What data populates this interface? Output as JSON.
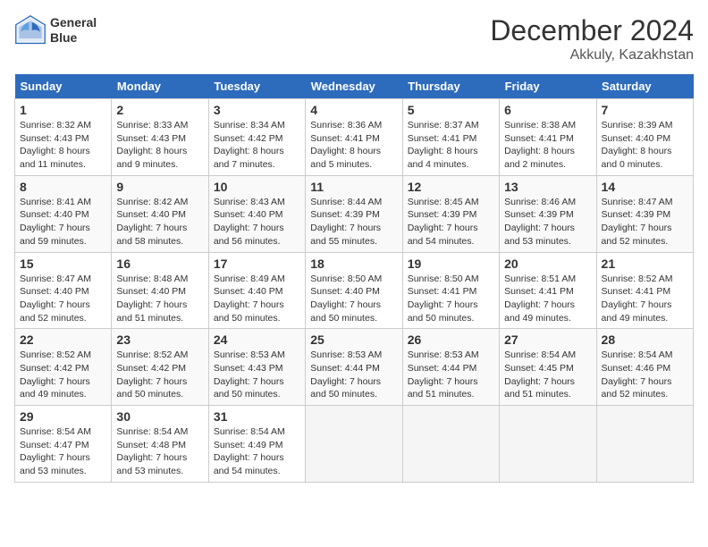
{
  "logo": {
    "line1": "General",
    "line2": "Blue"
  },
  "title": "December 2024",
  "location": "Akkuly, Kazakhstan",
  "weekdays": [
    "Sunday",
    "Monday",
    "Tuesday",
    "Wednesday",
    "Thursday",
    "Friday",
    "Saturday"
  ],
  "weeks": [
    [
      {
        "day": 1,
        "sunrise": "8:32 AM",
        "sunset": "4:43 PM",
        "daylight": "8 hours and 11 minutes."
      },
      {
        "day": 2,
        "sunrise": "8:33 AM",
        "sunset": "4:43 PM",
        "daylight": "8 hours and 9 minutes."
      },
      {
        "day": 3,
        "sunrise": "8:34 AM",
        "sunset": "4:42 PM",
        "daylight": "8 hours and 7 minutes."
      },
      {
        "day": 4,
        "sunrise": "8:36 AM",
        "sunset": "4:41 PM",
        "daylight": "8 hours and 5 minutes."
      },
      {
        "day": 5,
        "sunrise": "8:37 AM",
        "sunset": "4:41 PM",
        "daylight": "8 hours and 4 minutes."
      },
      {
        "day": 6,
        "sunrise": "8:38 AM",
        "sunset": "4:41 PM",
        "daylight": "8 hours and 2 minutes."
      },
      {
        "day": 7,
        "sunrise": "8:39 AM",
        "sunset": "4:40 PM",
        "daylight": "8 hours and 0 minutes."
      }
    ],
    [
      {
        "day": 8,
        "sunrise": "8:41 AM",
        "sunset": "4:40 PM",
        "daylight": "7 hours and 59 minutes."
      },
      {
        "day": 9,
        "sunrise": "8:42 AM",
        "sunset": "4:40 PM",
        "daylight": "7 hours and 58 minutes."
      },
      {
        "day": 10,
        "sunrise": "8:43 AM",
        "sunset": "4:40 PM",
        "daylight": "7 hours and 56 minutes."
      },
      {
        "day": 11,
        "sunrise": "8:44 AM",
        "sunset": "4:39 PM",
        "daylight": "7 hours and 55 minutes."
      },
      {
        "day": 12,
        "sunrise": "8:45 AM",
        "sunset": "4:39 PM",
        "daylight": "7 hours and 54 minutes."
      },
      {
        "day": 13,
        "sunrise": "8:46 AM",
        "sunset": "4:39 PM",
        "daylight": "7 hours and 53 minutes."
      },
      {
        "day": 14,
        "sunrise": "8:47 AM",
        "sunset": "4:39 PM",
        "daylight": "7 hours and 52 minutes."
      }
    ],
    [
      {
        "day": 15,
        "sunrise": "8:47 AM",
        "sunset": "4:40 PM",
        "daylight": "7 hours and 52 minutes."
      },
      {
        "day": 16,
        "sunrise": "8:48 AM",
        "sunset": "4:40 PM",
        "daylight": "7 hours and 51 minutes."
      },
      {
        "day": 17,
        "sunrise": "8:49 AM",
        "sunset": "4:40 PM",
        "daylight": "7 hours and 50 minutes."
      },
      {
        "day": 18,
        "sunrise": "8:50 AM",
        "sunset": "4:40 PM",
        "daylight": "7 hours and 50 minutes."
      },
      {
        "day": 19,
        "sunrise": "8:50 AM",
        "sunset": "4:41 PM",
        "daylight": "7 hours and 50 minutes."
      },
      {
        "day": 20,
        "sunrise": "8:51 AM",
        "sunset": "4:41 PM",
        "daylight": "7 hours and 49 minutes."
      },
      {
        "day": 21,
        "sunrise": "8:52 AM",
        "sunset": "4:41 PM",
        "daylight": "7 hours and 49 minutes."
      }
    ],
    [
      {
        "day": 22,
        "sunrise": "8:52 AM",
        "sunset": "4:42 PM",
        "daylight": "7 hours and 49 minutes."
      },
      {
        "day": 23,
        "sunrise": "8:52 AM",
        "sunset": "4:42 PM",
        "daylight": "7 hours and 50 minutes."
      },
      {
        "day": 24,
        "sunrise": "8:53 AM",
        "sunset": "4:43 PM",
        "daylight": "7 hours and 50 minutes."
      },
      {
        "day": 25,
        "sunrise": "8:53 AM",
        "sunset": "4:44 PM",
        "daylight": "7 hours and 50 minutes."
      },
      {
        "day": 26,
        "sunrise": "8:53 AM",
        "sunset": "4:44 PM",
        "daylight": "7 hours and 51 minutes."
      },
      {
        "day": 27,
        "sunrise": "8:54 AM",
        "sunset": "4:45 PM",
        "daylight": "7 hours and 51 minutes."
      },
      {
        "day": 28,
        "sunrise": "8:54 AM",
        "sunset": "4:46 PM",
        "daylight": "7 hours and 52 minutes."
      }
    ],
    [
      {
        "day": 29,
        "sunrise": "8:54 AM",
        "sunset": "4:47 PM",
        "daylight": "7 hours and 53 minutes."
      },
      {
        "day": 30,
        "sunrise": "8:54 AM",
        "sunset": "4:48 PM",
        "daylight": "7 hours and 53 minutes."
      },
      {
        "day": 31,
        "sunrise": "8:54 AM",
        "sunset": "4:49 PM",
        "daylight": "7 hours and 54 minutes."
      },
      null,
      null,
      null,
      null
    ]
  ]
}
